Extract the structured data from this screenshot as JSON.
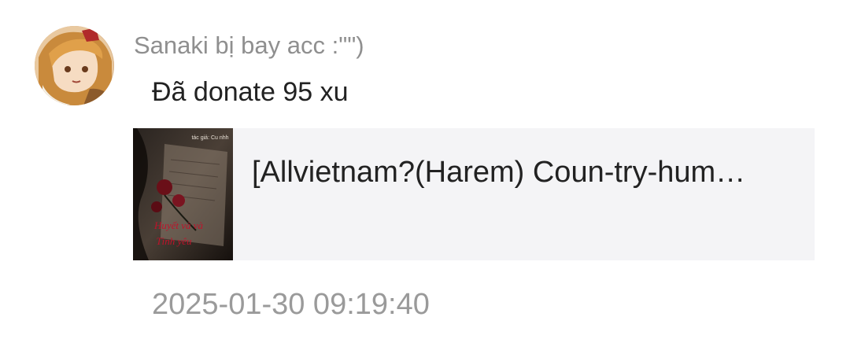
{
  "comment": {
    "username": "Sanaki bị bay acc :\"\")",
    "message": "Đã donate 95 xu",
    "timestamp": "2025-01-30 09:19:40",
    "avatar_icon": "anime-girl-avatar"
  },
  "story_card": {
    "title": "[Allvietnam?(Harem) Coun-try-hum…",
    "cover": {
      "brand_text": "tác giả: Cu nhh",
      "script_line1": "Huyết và và",
      "script_line2": "Tình yêu",
      "accent_color": "#c0122a"
    }
  }
}
